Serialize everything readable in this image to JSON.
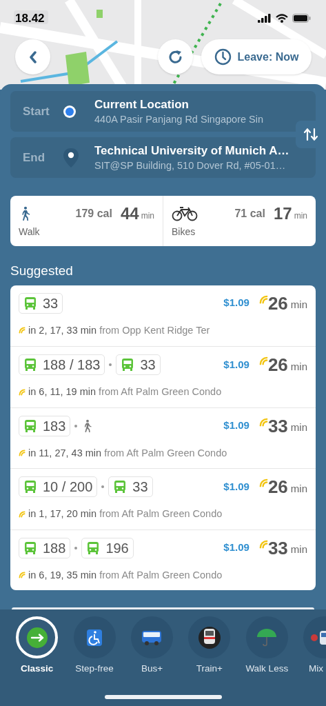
{
  "status_bar": {
    "time": "18.42"
  },
  "map_controls": {
    "leave_button": "Leave: Now"
  },
  "locations": [
    {
      "kind": "start",
      "label": "Start",
      "title": "Current Location",
      "subtitle": "440A Pasir Panjang Rd Singapore Sin"
    },
    {
      "kind": "end",
      "label": "End",
      "title": "Technical University of Munich A…",
      "subtitle": "SIT@SP Building, 510 Dover Rd, #05-01…"
    }
  ],
  "active_modes": [
    {
      "kind": "walk",
      "label": "Walk",
      "calories": "179 cal",
      "duration": "44",
      "unit": "min"
    },
    {
      "kind": "bike",
      "label": "Bikes",
      "calories": "71 cal",
      "duration": "17",
      "unit": "min"
    }
  ],
  "suggested": {
    "heading": "Suggested",
    "routes": [
      {
        "legs": [
          {
            "kind": "bus",
            "number": "33"
          }
        ],
        "fare": "$1.09",
        "duration": "26",
        "unit": "min",
        "arrivals": "in 2, 17, 33 min",
        "origin": "from Opp Kent Ridge Ter"
      },
      {
        "legs": [
          {
            "kind": "bus",
            "number": "188 / 183"
          },
          {
            "kind": "bus",
            "number": "33"
          }
        ],
        "fare": "$1.09",
        "duration": "26",
        "unit": "min",
        "arrivals": "in 6, 11, 19 min",
        "origin": "from Aft Palm Green Condo"
      },
      {
        "legs": [
          {
            "kind": "bus",
            "number": "183"
          },
          {
            "kind": "walk"
          }
        ],
        "fare": "$1.09",
        "duration": "33",
        "unit": "min",
        "arrivals": "in 11, 27, 43 min",
        "origin": "from Aft Palm Green Condo"
      },
      {
        "legs": [
          {
            "kind": "bus",
            "number": "10 / 200"
          },
          {
            "kind": "bus",
            "number": "33"
          }
        ],
        "fare": "$1.09",
        "duration": "26",
        "unit": "min",
        "arrivals": "in 1, 17, 20 min",
        "origin": "from Aft Palm Green Condo"
      },
      {
        "legs": [
          {
            "kind": "bus",
            "number": "188"
          },
          {
            "kind": "bus",
            "number": "196"
          }
        ],
        "fare": "$1.09",
        "duration": "33",
        "unit": "min",
        "arrivals": "in 6, 19, 35 min",
        "origin": "from Aft Palm Green Condo"
      }
    ]
  },
  "preferences": [
    {
      "kind": "classic",
      "label": "Classic",
      "selected": true
    },
    {
      "kind": "step_free",
      "label": "Step-free",
      "selected": false
    },
    {
      "kind": "bus",
      "label": "Bus+",
      "selected": false
    },
    {
      "kind": "train",
      "label": "Train+",
      "selected": false
    },
    {
      "kind": "umbrella",
      "label": "Walk Less",
      "selected": false
    },
    {
      "kind": "mix",
      "label": "Mix",
      "selected": false
    }
  ]
}
